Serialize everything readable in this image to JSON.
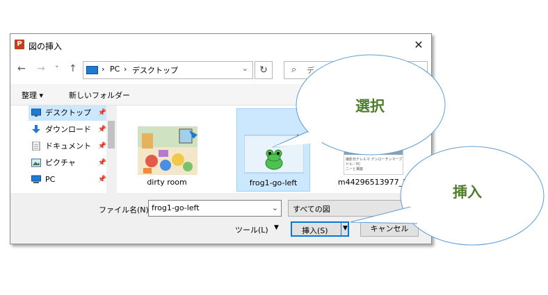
{
  "window": {
    "title": "図の挿入",
    "app_icon": "P",
    "close_glyph": "✕"
  },
  "nav": {
    "back": "←",
    "forward": "→",
    "recent": "˅",
    "up": "↑",
    "breadcrumbs": [
      "PC",
      "デスクトップ"
    ],
    "separator": "›",
    "address_dropdown": "⌄",
    "refresh": "↻",
    "search_placeholder": "デ"
  },
  "toolbar": {
    "organize": "整理 ▾",
    "new_folder": "新しいフォルダー"
  },
  "sidebar": {
    "items": [
      {
        "label": "デスクトップ",
        "icon": "desktop-icon",
        "pin": "📌"
      },
      {
        "label": "ダウンロード",
        "icon": "download-icon",
        "pin": "📌"
      },
      {
        "label": "ドキュメント",
        "icon": "document-icon",
        "pin": "📌"
      },
      {
        "label": "ピクチャ",
        "icon": "pictures-icon",
        "pin": "📌"
      },
      {
        "label": "PC",
        "icon": "pc-icon",
        "pin": "📌"
      }
    ]
  },
  "files": [
    {
      "name": "dirty room"
    },
    {
      "name": "frog1-go-left"
    },
    {
      "name": "m44296513977_2",
      "thumb_text": "撮影日テレルマ デンローチンマーブ ドル／PC\nニーと構築"
    }
  ],
  "bottom": {
    "filename_label": "ファイル名(N):",
    "filename_value": "frog1-go-left",
    "filename_dropdown": "⌄",
    "filter_value": "すべての図",
    "tools_label": "ツール(L)",
    "tools_arrow": "▼",
    "insert_label": "挿入(S)",
    "insert_arrow": "▼",
    "cancel_label": "キャンセル"
  },
  "callouts": [
    {
      "text": "選択"
    },
    {
      "text": "挿入"
    }
  ],
  "colors": {
    "accent": "#0078d7",
    "selection": "#cce8ff",
    "callout_text": "#4f7f2b",
    "callout_stroke": "#5b9bd5"
  }
}
